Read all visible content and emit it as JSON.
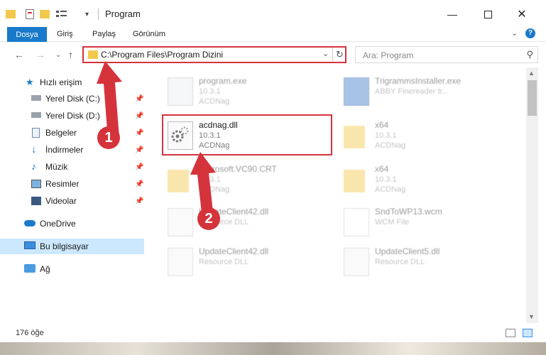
{
  "window": {
    "title": "Program"
  },
  "ribbon": {
    "tabs": [
      "Dosya",
      "Giriş",
      "Paylaş",
      "Görünüm"
    ]
  },
  "address": {
    "path": "C:\\Program Files\\Program Dizini",
    "search_placeholder": "Ara: Program"
  },
  "sidebar": {
    "items": [
      {
        "label": "Hızlı erişim",
        "icon": "star-icon"
      },
      {
        "label": "Yerel Disk (C:)",
        "icon": "drive-icon"
      },
      {
        "label": "Yerel Disk (D:)",
        "icon": "drive-icon"
      },
      {
        "label": "Belgeler",
        "icon": "documents-icon"
      },
      {
        "label": "İndirmeler",
        "icon": "download-icon"
      },
      {
        "label": "Müzik",
        "icon": "music-icon"
      },
      {
        "label": "Resimler",
        "icon": "pictures-icon"
      },
      {
        "label": "Videolar",
        "icon": "video-icon"
      },
      {
        "label": "OneDrive",
        "icon": "cloud-icon"
      },
      {
        "label": "Bu bilgisayar",
        "icon": "computer-icon"
      },
      {
        "label": "Ağ",
        "icon": "network-icon"
      }
    ]
  },
  "files": [
    {
      "name": "program.exe",
      "line1": "10.3.1",
      "line2": "ACDNag",
      "icon": "exe-icon"
    },
    {
      "name": "TrigrammsInstaller.exe",
      "line1": "ABBY Finereader tr...",
      "line2": "",
      "icon": "installer-icon"
    },
    {
      "name": "acdnag.dll",
      "line1": "10.3.1",
      "line2": "ACDNag",
      "icon": "dll-gear-icon"
    },
    {
      "name": "x64",
      "line1": "10.3.1",
      "line2": "ACDNag",
      "icon": "folder-icon"
    },
    {
      "name": "Microsoft.VC90.CRT",
      "line1": "10.3.1",
      "line2": "ACDNag",
      "icon": "folder-icon"
    },
    {
      "name": "x64",
      "line1": "10.3.1",
      "line2": "ACDNag",
      "icon": "folder-icon"
    },
    {
      "name": "UpdateClient42.dll",
      "line1": "Resource DLL",
      "line2": "",
      "icon": "dll-icon"
    },
    {
      "name": "SndToWP13.wcm",
      "line1": "WCM File",
      "line2": "",
      "icon": "file-icon"
    },
    {
      "name": "UpdateClient42.dll",
      "line1": "Resource DLL",
      "line2": "",
      "icon": "dll-icon"
    },
    {
      "name": "UpdateClient5.dll",
      "line1": "Resource DLL",
      "line2": "",
      "icon": "dll-icon"
    }
  ],
  "status": {
    "count": "176 öğe"
  },
  "annotations": {
    "step1": "1",
    "step2": "2"
  },
  "colors": {
    "accent": "#1979ca",
    "highlight": "#d5333c",
    "selected": "#cce8ff"
  }
}
